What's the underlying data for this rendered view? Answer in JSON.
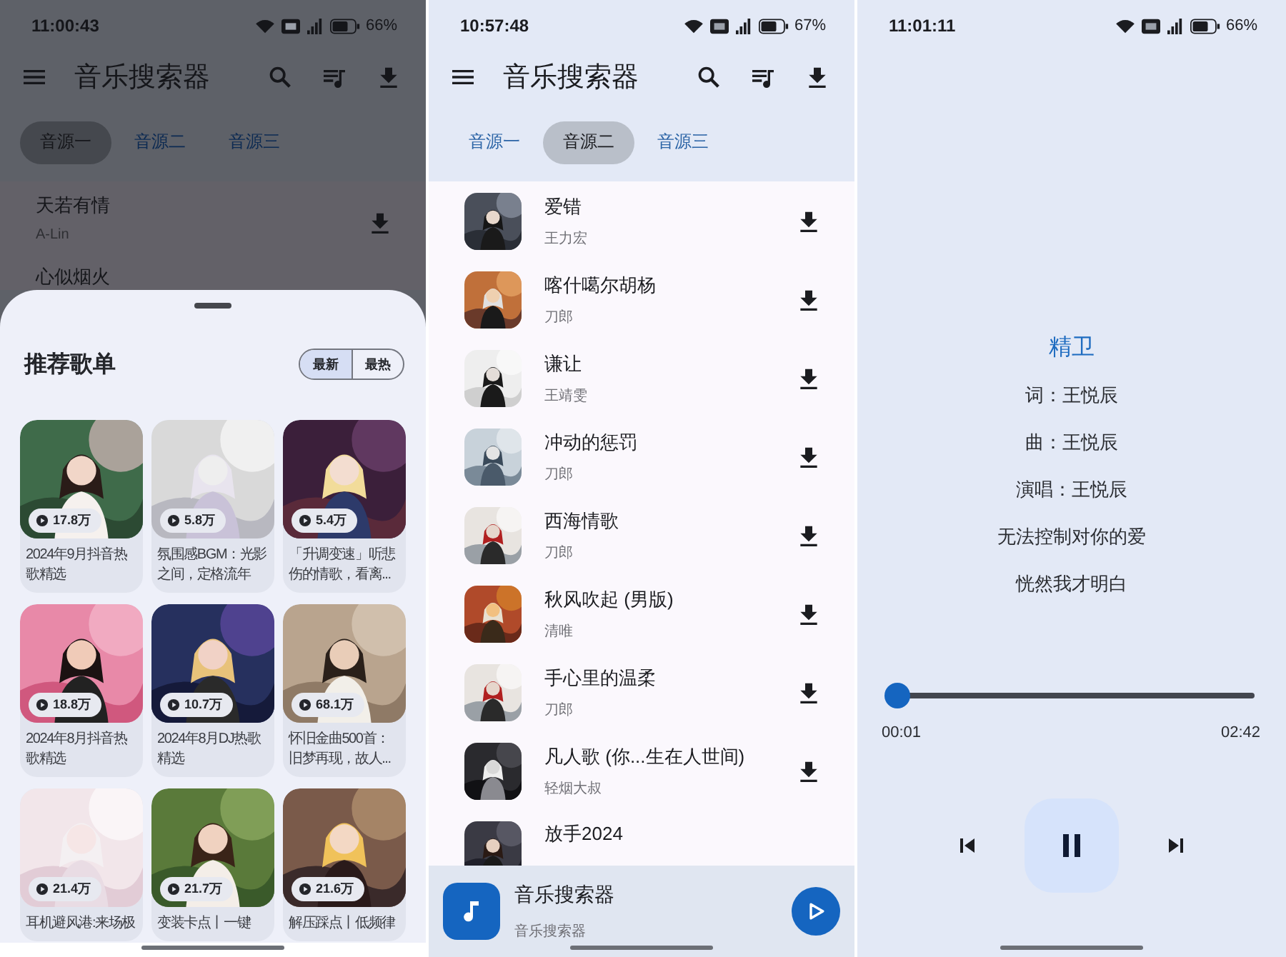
{
  "screens": [
    {
      "kind": "playlists",
      "dimmed": true,
      "status_bar": {
        "time": "11:00:43",
        "battery": "66%"
      },
      "app_bar": {
        "title": "音乐搜索器"
      },
      "tabs": [
        {
          "label": "音源一",
          "selected": true
        },
        {
          "label": "音源二",
          "selected": false
        },
        {
          "label": "音源三",
          "selected": false
        }
      ],
      "songs": [
        {
          "title": "天若有情",
          "artist": "A-Lin"
        },
        {
          "title": "心似烟火"
        }
      ],
      "sheet": {
        "title": "推荐歌单",
        "sort": [
          {
            "label": "最新",
            "selected": true
          },
          {
            "label": "最热",
            "selected": false
          }
        ],
        "playlists": [
          {
            "plays": "17.8万",
            "title": "2024年9月抖音热歌精选"
          },
          {
            "plays": "5.8万",
            "title": "氛围感BGM：光影之间，定格流年"
          },
          {
            "plays": "5.4万",
            "title": "「升调变速」听悲伤的情歌，看离..."
          },
          {
            "plays": "18.8万",
            "title": "2024年8月抖音热歌精选"
          },
          {
            "plays": "10.7万",
            "title": "2024年8月DJ热歌精选"
          },
          {
            "plays": "68.1万",
            "title": "怀旧金曲500首：旧梦再现，故人..."
          },
          {
            "plays": "21.4万",
            "title": "耳机避风港:来场极"
          },
          {
            "plays": "21.7万",
            "title": "变装卡点丨一键"
          },
          {
            "plays": "21.6万",
            "title": "解压踩点丨低频律"
          }
        ]
      }
    },
    {
      "kind": "songs",
      "dimmed": false,
      "status_bar": {
        "time": "10:57:48",
        "battery": "67%"
      },
      "app_bar": {
        "title": "音乐搜索器"
      },
      "tabs": [
        {
          "label": "音源一",
          "selected": false
        },
        {
          "label": "音源二",
          "selected": true
        },
        {
          "label": "音源三",
          "selected": false
        }
      ],
      "songs": [
        {
          "title": "爱错",
          "artist": "王力宏"
        },
        {
          "title": "喀什噶尔胡杨",
          "artist": "刀郎"
        },
        {
          "title": "谦让",
          "artist": "王靖雯"
        },
        {
          "title": "冲动的惩罚",
          "artist": "刀郎"
        },
        {
          "title": "西海情歌",
          "artist": "刀郎"
        },
        {
          "title": "秋风吹起 (男版)",
          "artist": "清唯"
        },
        {
          "title": "手心里的温柔",
          "artist": "刀郎"
        },
        {
          "title": "凡人歌 (你...生在人世间)",
          "artist": "轻烟大叔"
        },
        {
          "title": "放手2024"
        }
      ],
      "mini_player": {
        "title": "音乐搜索器",
        "subtitle": "音乐搜索器",
        "playing": false
      }
    },
    {
      "kind": "player",
      "dimmed": false,
      "status_bar": {
        "time": "11:01:11",
        "battery": "66%"
      },
      "lyrics": [
        {
          "text": "精卫",
          "highlighted": true
        },
        {
          "text": "词：王悦辰",
          "highlighted": false
        },
        {
          "text": "曲：王悦辰",
          "highlighted": false
        },
        {
          "text": "演唱：王悦辰",
          "highlighted": false
        },
        {
          "text": "无法控制对你的爱",
          "highlighted": false
        },
        {
          "text": "恍然我才明白",
          "highlighted": false
        }
      ],
      "progress": {
        "level": 0.006,
        "elapsed": "00:01",
        "total": "02:42"
      },
      "playing": true
    }
  ]
}
